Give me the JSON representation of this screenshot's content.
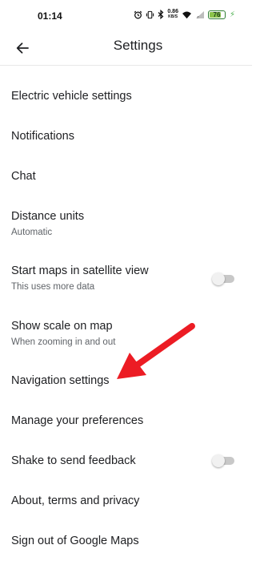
{
  "status_bar": {
    "time": "01:14",
    "net_speed_value": "0.86",
    "net_speed_unit": "KB/S",
    "battery_level": "76",
    "battery_fraction": 0.76,
    "icons": [
      "alarm-icon",
      "vibrate-icon",
      "bluetooth-icon",
      "wifi-icon",
      "signal-icon",
      "battery-icon",
      "charging-icon"
    ]
  },
  "app_bar": {
    "back_icon": "back-arrow-icon",
    "title": "Settings"
  },
  "settings_items": [
    {
      "title": "Electric vehicle settings"
    },
    {
      "title": "Notifications"
    },
    {
      "title": "Chat"
    },
    {
      "title": "Distance units",
      "subtitle": "Automatic"
    },
    {
      "title": "Start maps in satellite view",
      "subtitle": "This uses more data",
      "toggle": false
    },
    {
      "title": "Show scale on map",
      "subtitle": "When zooming in and out"
    },
    {
      "title": "Navigation settings"
    },
    {
      "title": "Manage your preferences"
    },
    {
      "title": "Shake to send feedback",
      "toggle": false
    },
    {
      "title": "About, terms and privacy"
    },
    {
      "title": "Sign out of Google Maps"
    }
  ],
  "annotation": {
    "type": "arrow",
    "color": "#ec1c24",
    "points_to": "Navigation settings"
  }
}
